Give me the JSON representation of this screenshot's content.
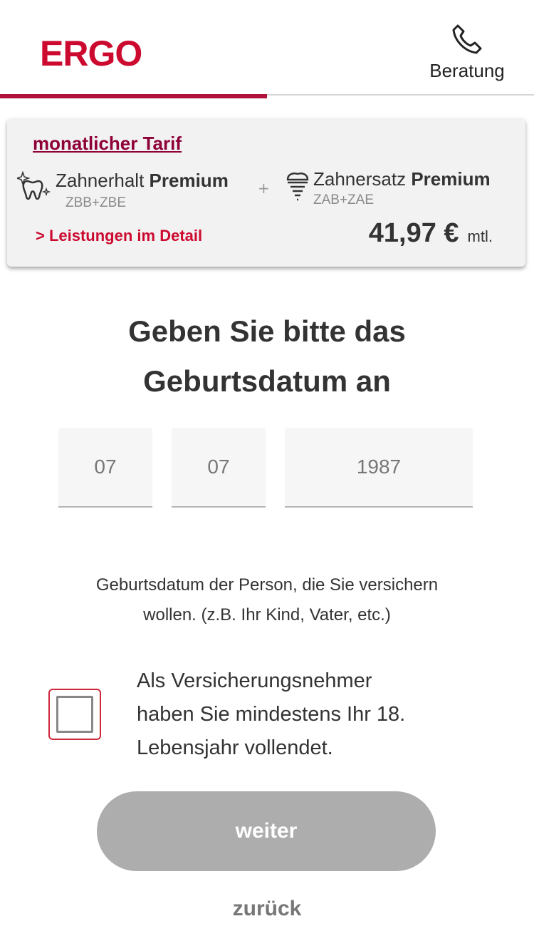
{
  "header": {
    "logo": "ERGO",
    "consult_label": "Beratung",
    "progress": 0.5,
    "brand_color": "#cc0a2f",
    "accent_color": "#b0123c"
  },
  "tariff_card": {
    "title": "monatlicher Tarif",
    "products": [
      {
        "name": "Zahnerhalt",
        "tier": "Premium",
        "code": "ZBB+ZBE",
        "icon": "tooth-sparkle-icon"
      },
      {
        "name": "Zahnersatz",
        "tier": "Premium",
        "code": "ZAB+ZAE",
        "icon": "dental-implant-icon"
      }
    ],
    "plus": "+",
    "details_link": "> Leistungen im Detail",
    "price": "41,97 €",
    "price_period": "mtl."
  },
  "form": {
    "heading_line1": "Geben Sie bitte das",
    "heading_line2": "Geburtsdatum an",
    "day": "07",
    "month": "07",
    "year": "1987",
    "hint_line1": "Geburtsdatum der Person, die Sie versichern",
    "hint_line2": "wollen. (z.B. Ihr Kind, Vater, etc.)",
    "checkbox_line1": "Als Versicherungsnehmer",
    "checkbox_line2": "haben Sie mindestens Ihr 18.",
    "checkbox_line3": "Lebensjahr vollendet.",
    "checkbox_checked": false
  },
  "actions": {
    "next_label": "weiter",
    "back_label": "zurück"
  }
}
